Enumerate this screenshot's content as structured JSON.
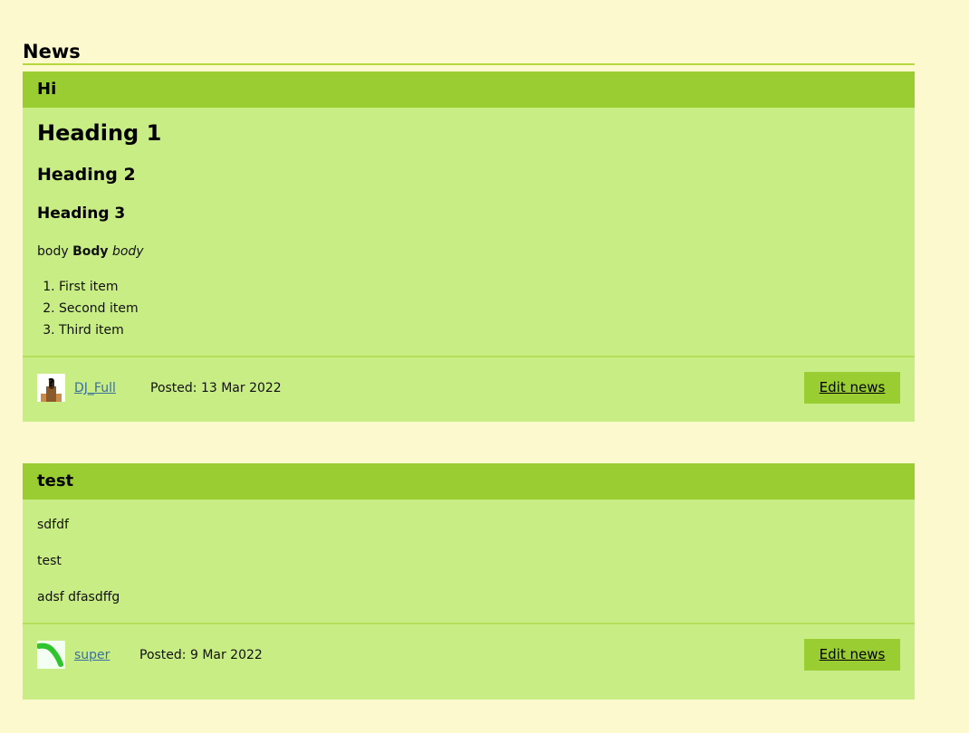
{
  "section": {
    "title": "News"
  },
  "posts": [
    {
      "title": "Hi",
      "heading1": "Heading 1",
      "heading2": "Heading 2",
      "heading3": "Heading 3",
      "body_plain": "body",
      "body_bold": "Body",
      "body_italic": "body",
      "list": [
        "First item",
        "Second item",
        "Third item"
      ],
      "author": "DJ_Full",
      "posted": "Posted: 13 Mar 2022",
      "edit_label": "Edit news"
    },
    {
      "title": "test",
      "paragraphs": [
        "sdfdf",
        "test",
        "adsf dfasdffg"
      ],
      "author": "super",
      "posted": "Posted: 9 Mar 2022",
      "edit_label": "Edit news"
    }
  ]
}
